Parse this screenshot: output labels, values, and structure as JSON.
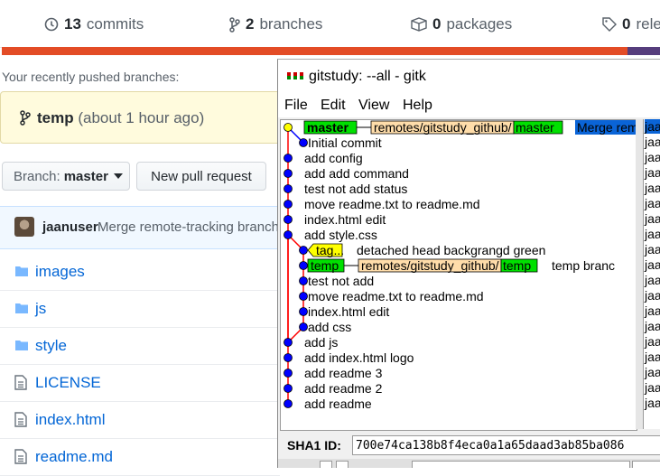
{
  "repo_stats": {
    "commits_count": "13",
    "commits_label": "commits",
    "branches_count": "2",
    "branches_label": "branches",
    "packages_count": "0",
    "packages_label": "packages",
    "releases_count": "0",
    "releases_label": "rele"
  },
  "recent_branches": {
    "label": "Your recently pushed branches:",
    "branch": "temp",
    "time": "(about 1 hour ago)"
  },
  "toolbar": {
    "branch_label": "Branch:",
    "branch_value": "master",
    "new_pr_label": "New pull request"
  },
  "latest_commit": {
    "user": "jaanuser",
    "message": "Merge remote-tracking branch"
  },
  "files": [
    {
      "name": "images",
      "type": "folder"
    },
    {
      "name": "js",
      "type": "folder"
    },
    {
      "name": "style",
      "type": "folder"
    },
    {
      "name": "LICENSE",
      "type": "file"
    },
    {
      "name": "index.html",
      "type": "file"
    },
    {
      "name": "readme.md",
      "type": "file"
    }
  ],
  "gitk": {
    "title": "gitstudy: --all - gitk",
    "menu": [
      "File",
      "Edit",
      "View",
      "Help"
    ],
    "commits": [
      {
        "msg": "Merge rem",
        "col": 0,
        "tags": [
          {
            "text": "master",
            "kind": "local"
          },
          {
            "text": "remotes/gitstudy_github/",
            "kind": "remote",
            "tail": "master"
          }
        ],
        "highlight": true
      },
      {
        "msg": "Initial commit",
        "col": 1,
        "tags": []
      },
      {
        "msg": "add config",
        "col": 0,
        "tags": []
      },
      {
        "msg": "add add command",
        "col": 0,
        "tags": []
      },
      {
        "msg": "test not add status",
        "col": 0,
        "tags": []
      },
      {
        "msg": "move readme.txt to readme.md",
        "col": 0,
        "tags": []
      },
      {
        "msg": "index.html edit",
        "col": 0,
        "tags": []
      },
      {
        "msg": "add style.css",
        "col": 0,
        "tags": []
      },
      {
        "msg": "detached head backgrangd green",
        "col": 1,
        "tags": [
          {
            "text": "tag...",
            "kind": "tag"
          }
        ]
      },
      {
        "msg": "temp branc",
        "col": 1,
        "tags": [
          {
            "text": "temp",
            "kind": "local"
          },
          {
            "text": "remotes/gitstudy_github/",
            "kind": "remote",
            "tail": "temp"
          }
        ]
      },
      {
        "msg": "test not add",
        "col": 1,
        "tags": []
      },
      {
        "msg": "move readme.txt to readme.md",
        "col": 1,
        "tags": []
      },
      {
        "msg": "index.html edit",
        "col": 1,
        "tags": []
      },
      {
        "msg": "add css",
        "col": 1,
        "tags": []
      },
      {
        "msg": "add js",
        "col": 0,
        "tags": []
      },
      {
        "msg": "add index.html logo",
        "col": 0,
        "tags": []
      },
      {
        "msg": "add readme 3",
        "col": 0,
        "tags": []
      },
      {
        "msg": "add readme 2",
        "col": 0,
        "tags": []
      },
      {
        "msg": "add readme",
        "col": 0,
        "tags": []
      }
    ],
    "author_fragment": "jaa",
    "sha_label": "SHA1 ID:",
    "sha_value": "700e74ca138b8f4eca0a1a65daad3ab85ba086"
  },
  "colors": {
    "tag_local_green": "#00e000",
    "tag_remote_tan": "#ffddaa",
    "tag_yellow": "#ffff00",
    "node_blue": "#0000ff",
    "node_head_yellow": "#ffff00",
    "line_red": "#ff0000",
    "select_blue": "#0a64d7",
    "link_blue": "#0366d6"
  },
  "icons": {
    "commits": "history-icon",
    "branches": "git-branch-icon",
    "packages": "package-icon",
    "releases": "tag-icon",
    "folder": "folder-icon",
    "file": "file-icon",
    "gitk": "gitk-app-icon"
  }
}
